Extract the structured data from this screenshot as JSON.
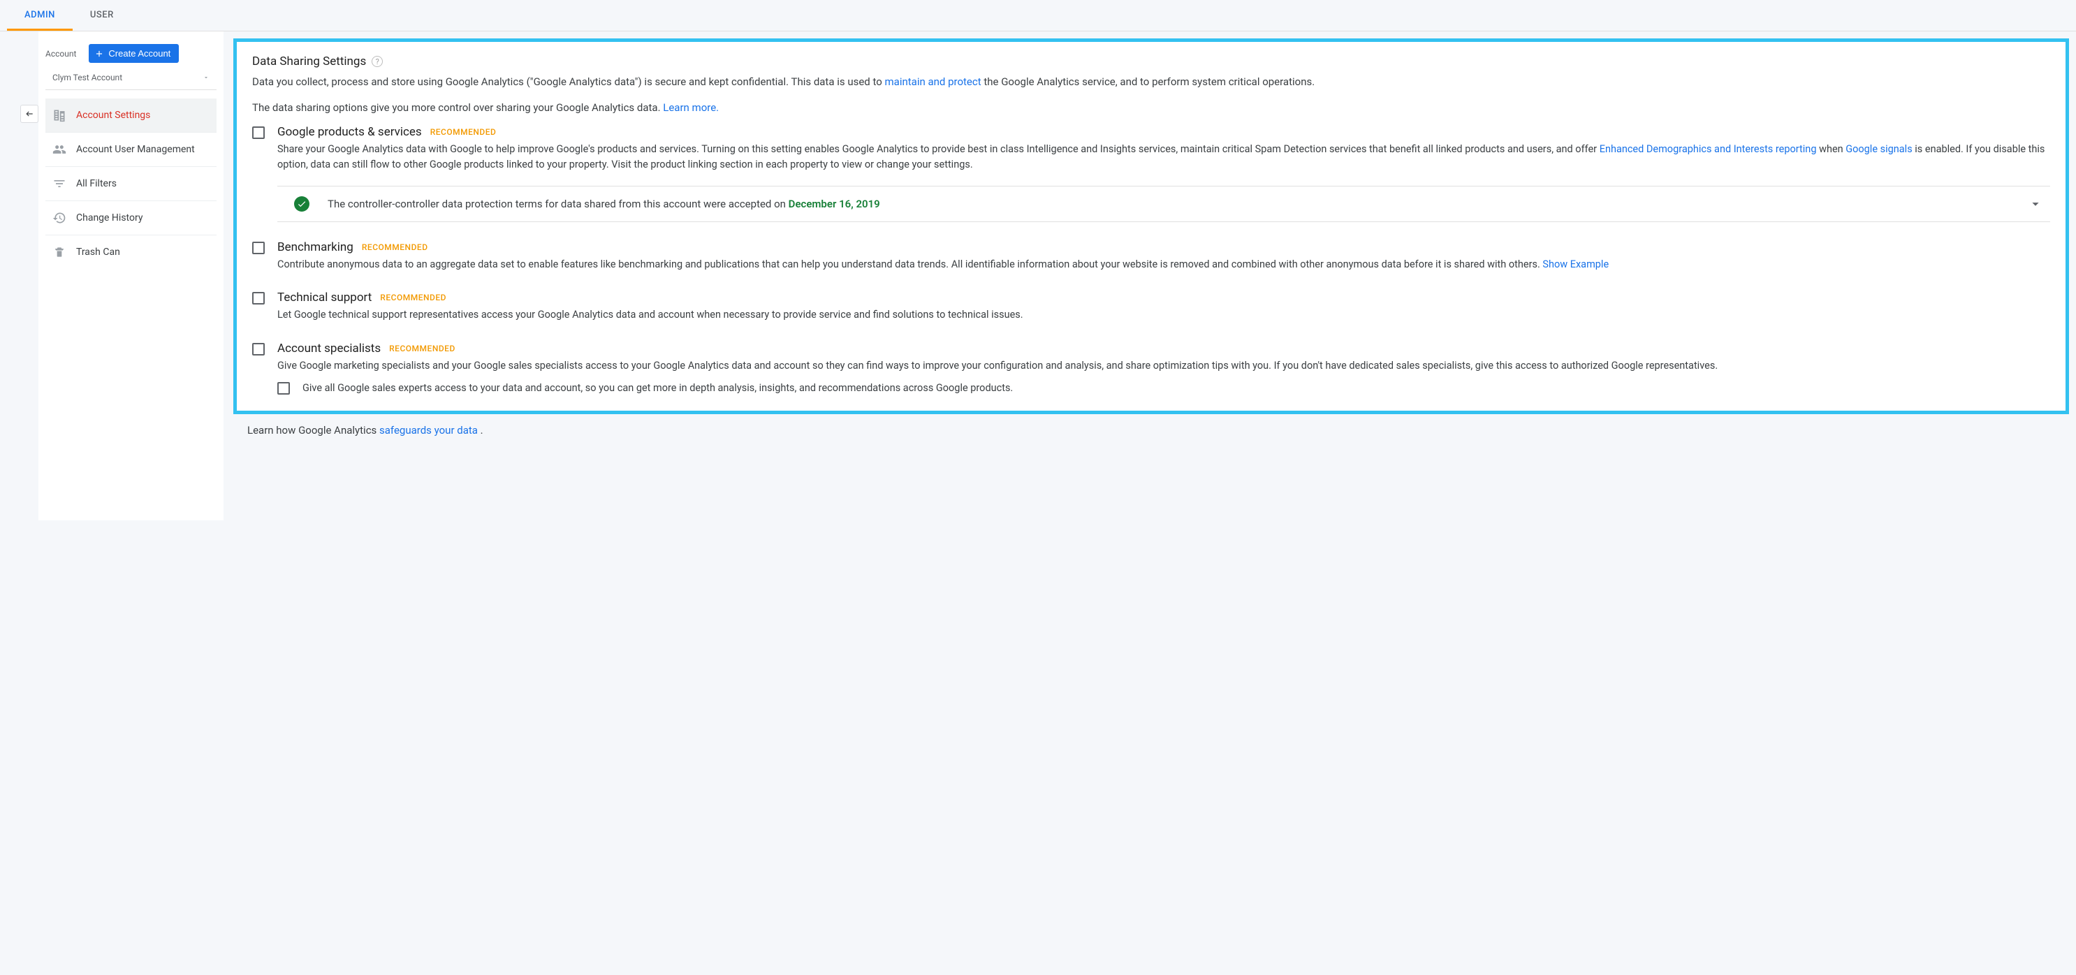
{
  "tabs": {
    "admin": "ADMIN",
    "user": "USER"
  },
  "sidebar": {
    "account_label": "Account",
    "create_btn": "Create Account",
    "account_name": "Clym Test Account",
    "items": [
      {
        "label": "Account Settings"
      },
      {
        "label": "Account User Management"
      },
      {
        "label": "All Filters"
      },
      {
        "label": "Change History"
      },
      {
        "label": "Trash Can"
      }
    ]
  },
  "panel": {
    "title": "Data Sharing Settings",
    "intro1_a": "Data you collect, process and store using Google Analytics (\"Google Analytics data\") is secure and kept confidential. This data is used to ",
    "intro1_link": "maintain and protect",
    "intro1_b": " the Google Analytics service, and to perform system critical operations.",
    "intro2_a": "The data sharing options give you more control over sharing your Google Analytics data. ",
    "intro2_link": "Learn more.",
    "recommended_label": "RECOMMENDED",
    "setting1": {
      "title": "Google products & services",
      "desc_a": "Share your Google Analytics data with Google to help improve Google's products and services. Turning on this setting enables Google Analytics to provide best in class Intelligence and Insights services, maintain critical Spam Detection services that benefit all linked products and users, and offer ",
      "link1": "Enhanced Demographics and Interests reporting",
      "desc_b": " when ",
      "link2": "Google signals",
      "desc_c": " is enabled. If you disable this option, data can still flow to other Google products linked to your property. Visit the product linking section in each property to view or change your settings.",
      "terms_a": "The controller-controller data protection terms for data shared from this account were accepted on ",
      "terms_date": "December 16, 2019"
    },
    "setting2": {
      "title": "Benchmarking",
      "desc_a": "Contribute anonymous data to an aggregate data set to enable features like benchmarking and publications that can help you understand data trends. All identifiable information about your website is removed and combined with other anonymous data before it is shared with others. ",
      "link": "Show Example"
    },
    "setting3": {
      "title": "Technical support",
      "desc": "Let Google technical support representatives access your Google Analytics data and account when necessary to provide service and find solutions to technical issues."
    },
    "setting4": {
      "title": "Account specialists",
      "desc": "Give Google marketing specialists and your Google sales specialists access to your Google Analytics data and account so they can find ways to improve your configuration and analysis, and share optimization tips with you. If you don't have dedicated sales specialists, give this access to authorized Google representatives.",
      "sub_desc": "Give all Google sales experts access to your data and account, so you can get more in depth analysis, insights, and recommendations across Google products."
    },
    "footer_a": "Learn how Google Analytics ",
    "footer_link": "safeguards your data",
    "footer_b": " ."
  }
}
